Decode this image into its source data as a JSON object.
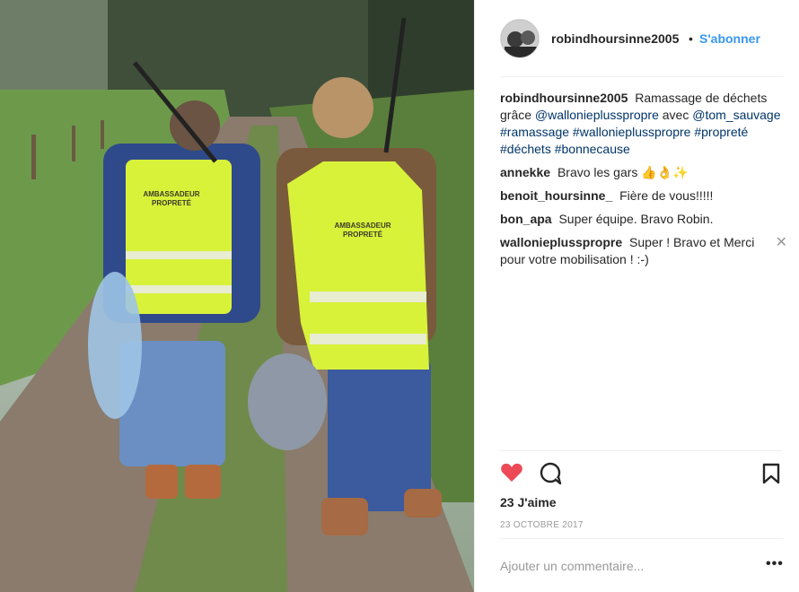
{
  "post": {
    "username": "robindhoursinne2005",
    "dot": "•",
    "follow_label": "S'abonner",
    "vest_text_line1": "AMBASSADEUR",
    "vest_text_line2": "PROPRETÉ"
  },
  "caption": {
    "username": "robindhoursinne2005",
    "text_before": "Ramassage de déchets grâce",
    "mention1": "@wallonieplusspropre",
    "text_mid": "avec",
    "mention2": "@tom_sauvage",
    "hashtags": "#ramassage #wallonieplusspropre #propreté #déchets #bonnecause"
  },
  "comments": [
    {
      "username": "annekke",
      "text": "Bravo les gars 👍👌✨"
    },
    {
      "username": "benoit_hoursinne_",
      "text": "Fière de vous!!!!!"
    },
    {
      "username": "bon_apa",
      "text": "Super équipe. Bravo Robin."
    },
    {
      "username": "wallonieplusspropre",
      "text": "Super ! Bravo et Merci pour votre mobilisation ! :-)",
      "close": "✕"
    }
  ],
  "stats": {
    "likes": "23 J'aime",
    "date": "23 OCTOBRE 2017"
  },
  "add_comment": {
    "placeholder": "Ajouter un commentaire...",
    "more": "•••"
  },
  "icons": [
    "heart-icon",
    "comment-icon",
    "bookmark-icon"
  ],
  "colors": {
    "accent": "#3897f0",
    "like_red": "#ed4956",
    "vest": "#d8f23a"
  }
}
